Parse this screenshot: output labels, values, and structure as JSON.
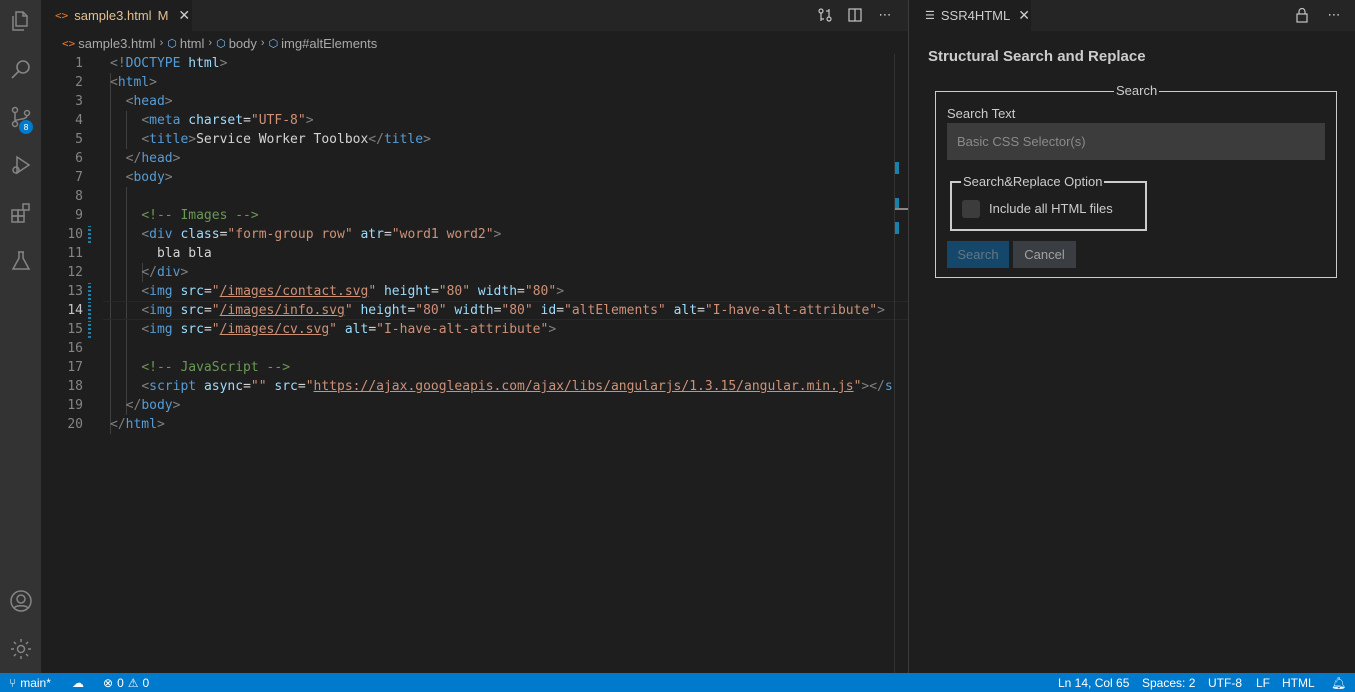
{
  "activity_bar": {
    "icons": [
      "files-icon",
      "search-icon",
      "source-control-icon",
      "run-debug-icon",
      "extensions-icon",
      "testing-icon",
      "account-icon",
      "settings-gear-icon"
    ],
    "source_control_badge": "8"
  },
  "editor": {
    "tab": {
      "name": "sample3.html",
      "status": "M"
    },
    "breadcrumb": [
      "sample3.html",
      "html",
      "body",
      "img#altElements"
    ],
    "current_line": 14,
    "lines": [
      "1",
      "2",
      "3",
      "4",
      "5",
      "6",
      "7",
      "8",
      "9",
      "10",
      "11",
      "12",
      "13",
      "14",
      "15",
      "16",
      "17",
      "18",
      "19",
      "20"
    ]
  },
  "panel": {
    "tab_title": "SSR4HTML",
    "heading": "Structural Search and Replace",
    "fieldset_legend": "Search",
    "search_label": "Search Text",
    "search_placeholder": "Basic CSS Selector(s)",
    "search_value": "",
    "option_legend": "Search&Replace Option",
    "checkbox_label": "Include all HTML files",
    "checkbox_checked": false,
    "search_button": "Search",
    "cancel_button": "Cancel"
  },
  "statusbar": {
    "branch": "main*",
    "errors": "0",
    "warnings": "0",
    "position": "Ln 14, Col 65",
    "spaces": "Spaces: 2",
    "encoding": "UTF-8",
    "eol": "LF",
    "language": "HTML"
  },
  "colors": {
    "accent": "#007acc",
    "editor_bg": "#1e1e1e",
    "activity_bg": "#333333",
    "tag": "#569cd6",
    "attribute": "#9cdcfe",
    "string": "#ce9178",
    "comment": "#6a9955"
  }
}
